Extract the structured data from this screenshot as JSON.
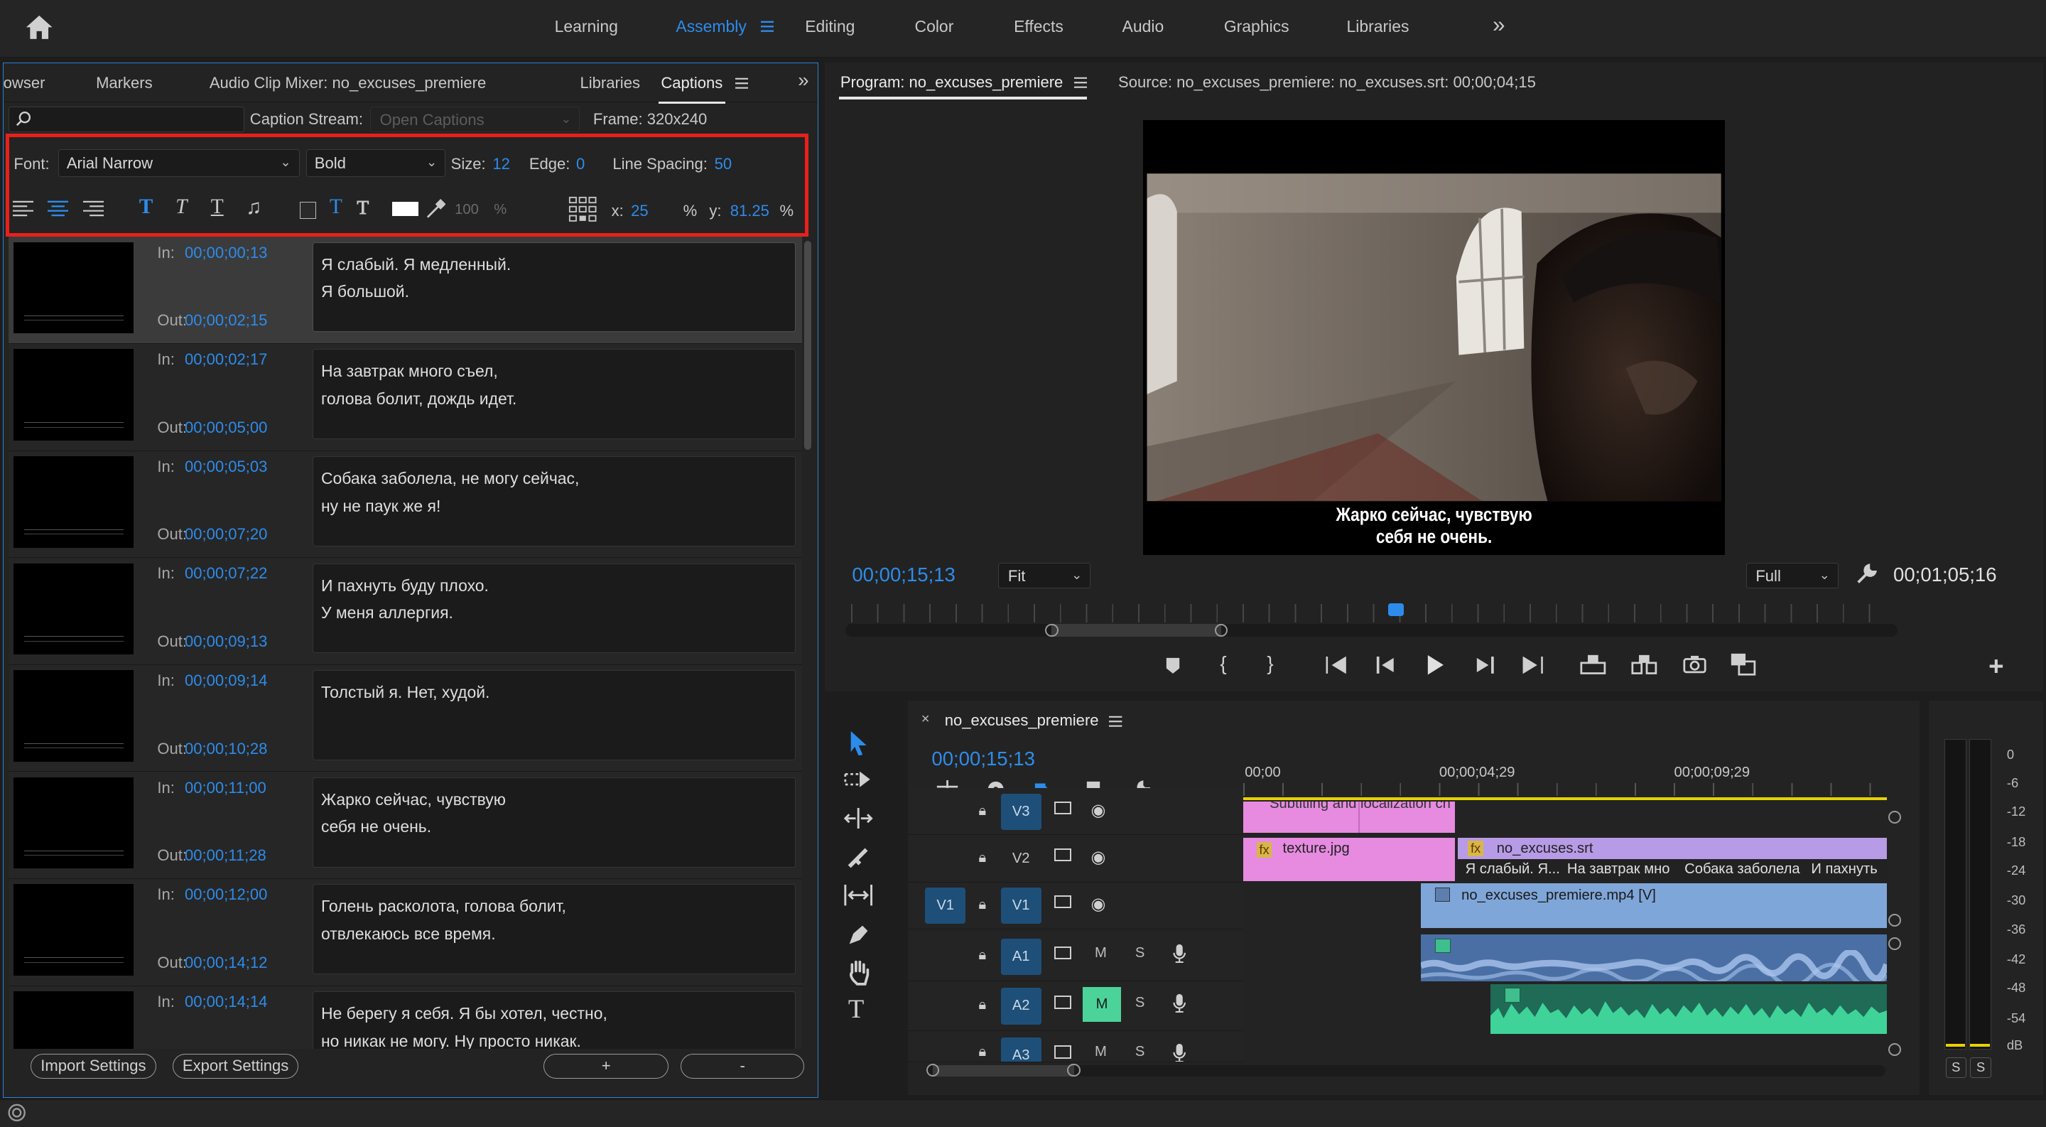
{
  "topbar": {
    "workspaces": [
      "Learning",
      "Assembly",
      "Editing",
      "Color",
      "Effects",
      "Audio",
      "Graphics",
      "Libraries"
    ],
    "active_workspace": "Assembly",
    "overflow": "»"
  },
  "left_panel": {
    "tabs": [
      "owser",
      "Markers",
      "Audio Clip Mixer: no_excuses_premiere",
      "Libraries",
      "Captions"
    ],
    "active_tab": "Captions",
    "search_placeholder": "",
    "caption_stream_label": "Caption Stream:",
    "caption_stream_value": "Open Captions",
    "frame_label": "Frame: 320x240",
    "font_label": "Font:",
    "font_value": "Arial Narrow",
    "style_value": "Bold",
    "size_label": "Size:",
    "size_value": "12",
    "edge_label": "Edge:",
    "edge_value": "0",
    "line_spacing_label": "Line Spacing:",
    "line_spacing_value": "50",
    "opacity_value": "100",
    "opacity_unit": "%",
    "x_label": "x:",
    "x_value": "25",
    "x_unit": "%",
    "y_label": "y:",
    "y_value": "81.25",
    "y_unit": "%",
    "in_label": "In:",
    "out_label": "Out:",
    "captions": [
      {
        "in": "00;00;00;13",
        "out": "00;00;02;15",
        "text": "Я слабый. Я медленный.\nЯ большой."
      },
      {
        "in": "00;00;02;17",
        "out": "00;00;05;00",
        "text": "На завтрак много съел,\nголова болит, дождь идет."
      },
      {
        "in": "00;00;05;03",
        "out": "00;00;07;20",
        "text": "Собака заболела, не могу сейчас,\nну не паук же я!"
      },
      {
        "in": "00;00;07;22",
        "out": "00;00;09;13",
        "text": "И пахнуть буду плохо.\nУ меня аллергия."
      },
      {
        "in": "00;00;09;14",
        "out": "00;00;10;28",
        "text": "Толстый я. Нет, худой."
      },
      {
        "in": "00;00;11;00",
        "out": "00;00;11;28",
        "text": "Жарко сейчас, чувствую\nсебя не очень."
      },
      {
        "in": "00;00;12;00",
        "out": "00;00;14;12",
        "text": "Голень расколота, голова болит,\nотвлекаюсь все время."
      },
      {
        "in": "00;00;14;14",
        "out": "",
        "text": "Не берегу я себя. Я бы хотел, честно,\nно никак не могу. Ну просто никак."
      }
    ],
    "import_button": "Import Settings",
    "export_button": "Export Settings",
    "add_button": "+",
    "remove_button": "-"
  },
  "program_monitor": {
    "tab": "Program: no_excuses_premiere",
    "source_tab": "Source: no_excuses_premiere: no_excuses.srt: 00;00;04;15",
    "subtitle_line1": "Жарко сейчас, чувствую",
    "subtitle_line2": "себя не очень.",
    "current_time": "00;00;15;13",
    "zoom": "Fit",
    "quality": "Full",
    "duration": "00;01;05;16",
    "add_button": "+"
  },
  "timeline": {
    "sequence_name": "no_excuses_premiere",
    "timecode": "00;00;15;13",
    "ruler": [
      "00;00",
      "00;00;04;29",
      "00;00;09;29"
    ],
    "tracks": [
      {
        "name": "V3"
      },
      {
        "name": "V2"
      },
      {
        "name": "V1",
        "source": "V1"
      },
      {
        "name": "A1",
        "m": "M",
        "s": "S"
      },
      {
        "name": "A2",
        "m": "M",
        "s": "S"
      },
      {
        "name": "A3",
        "m": "M",
        "s": "S"
      }
    ],
    "clips": {
      "v3_title": "Subtitling and localization  ch",
      "texture": "texture.jpg",
      "srt": "no_excuses.srt",
      "srt_segments": [
        "Я слабый. Я...",
        "На завтрак мно",
        "Собака заболела",
        "И пахнуть"
      ],
      "video": "no_excuses_premiere.mp4 [V]"
    },
    "fx": "fx"
  },
  "meter": {
    "scale": [
      "0",
      "-6",
      "-12",
      "-18",
      "-24",
      "-30",
      "-36",
      "-42",
      "-48",
      "-54",
      "dB"
    ],
    "solo_buttons": [
      "S",
      "S"
    ]
  },
  "colors": {
    "accent": "#2d8ceb",
    "highlight_box": "#e8201b",
    "clip_pink": "#e68be0",
    "clip_purple": "#b79be6",
    "clip_blue": "#7fa6d9",
    "audio_green": "#3fbf8e"
  }
}
